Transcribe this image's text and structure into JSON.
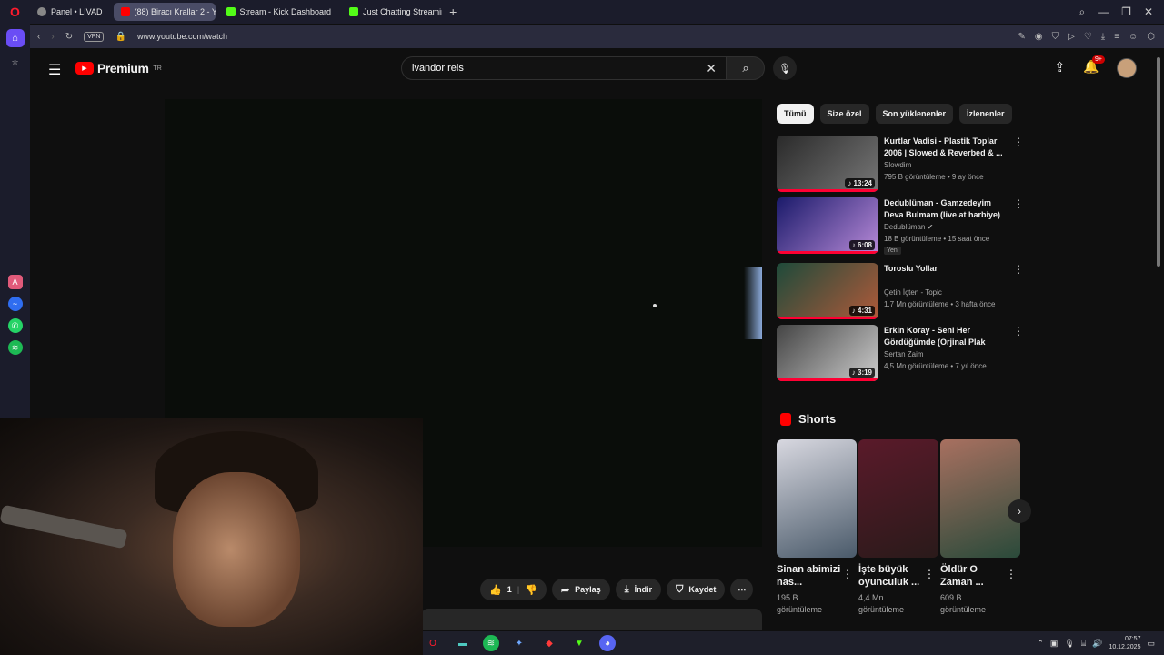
{
  "browser": {
    "tabs": [
      {
        "label": "Panel • LIVAD",
        "active": false,
        "icon": "panel-icon"
      },
      {
        "label": "(88) Biracı Krallar 2 - YouT",
        "active": true,
        "icon": "youtube-icon"
      },
      {
        "label": "Stream - Kick Dashboard",
        "active": false,
        "icon": "kick-icon"
      },
      {
        "label": "Just Chatting Streaming -",
        "active": false,
        "icon": "kick-icon"
      }
    ],
    "new_tab": "+",
    "vpn": "VPN",
    "url": "www.youtube.com/watch"
  },
  "youtube": {
    "logo_text": "Premium",
    "logo_region": "TR",
    "search_value": "ivandor reis",
    "notifications": "9+",
    "actions": {
      "likes": "1",
      "share": "Paylaş",
      "download": "İndir",
      "save": "Kaydet"
    },
    "chips": [
      "Tümü",
      "Size özel",
      "Son yüklenenler",
      "İzlenenler"
    ],
    "recommendations": [
      {
        "title": "Kurtlar Vadisi - Plastik Toplar 2006 | Slowed & Reverbed & ...",
        "channel": "Slowdim",
        "meta": "795 B görüntüleme • 9 ay önce",
        "duration": "♪ 13:24",
        "badge": "",
        "colors": [
          "#2a2a2a",
          "#777"
        ]
      },
      {
        "title": "Dedublüman - Gamzedeyim Deva Bulmam (live at harbiye)",
        "channel": "Dedublüman ✔",
        "meta": "18 B görüntüleme • 15 saat önce",
        "duration": "♪ 6:08",
        "badge": "Yeni",
        "colors": [
          "#1a1a6a",
          "#b88ad8"
        ]
      },
      {
        "title": "Toroslu Yollar",
        "channel": "Çetin İçten - Topic",
        "meta": "1,7 Mn görüntüleme • 3 hafta önce",
        "duration": "♪ 4:31",
        "badge": "",
        "colors": [
          "#1e4a3a",
          "#b05a3a"
        ]
      },
      {
        "title": "Erkin Koray - Seni Her Gördüğümde (Orjinal Plak Kayıt)",
        "channel": "Sertan Zaim",
        "meta": "4,5 Mn görüntüleme • 7 yıl önce",
        "duration": "♪ 3:19",
        "badge": "",
        "colors": [
          "#444",
          "#ccc"
        ]
      }
    ],
    "shorts_title": "Shorts",
    "shorts": [
      {
        "title": "Sinan abimizi nas...",
        "views": "195 B görüntüleme",
        "colors": [
          "#d8d8e0",
          "#4a5a6a"
        ]
      },
      {
        "title": "İşte büyük oyunculuk ...",
        "views": "4,4 Mn görüntüleme",
        "colors": [
          "#5a1a2a",
          "#2a1a1a"
        ]
      },
      {
        "title": "Öldür O Zaman ...",
        "views": "609 B görüntüleme",
        "colors": [
          "#a87060",
          "#2a4a3a"
        ]
      }
    ]
  },
  "taskbar": {
    "time": "07:57",
    "date": "10.12.2025"
  }
}
